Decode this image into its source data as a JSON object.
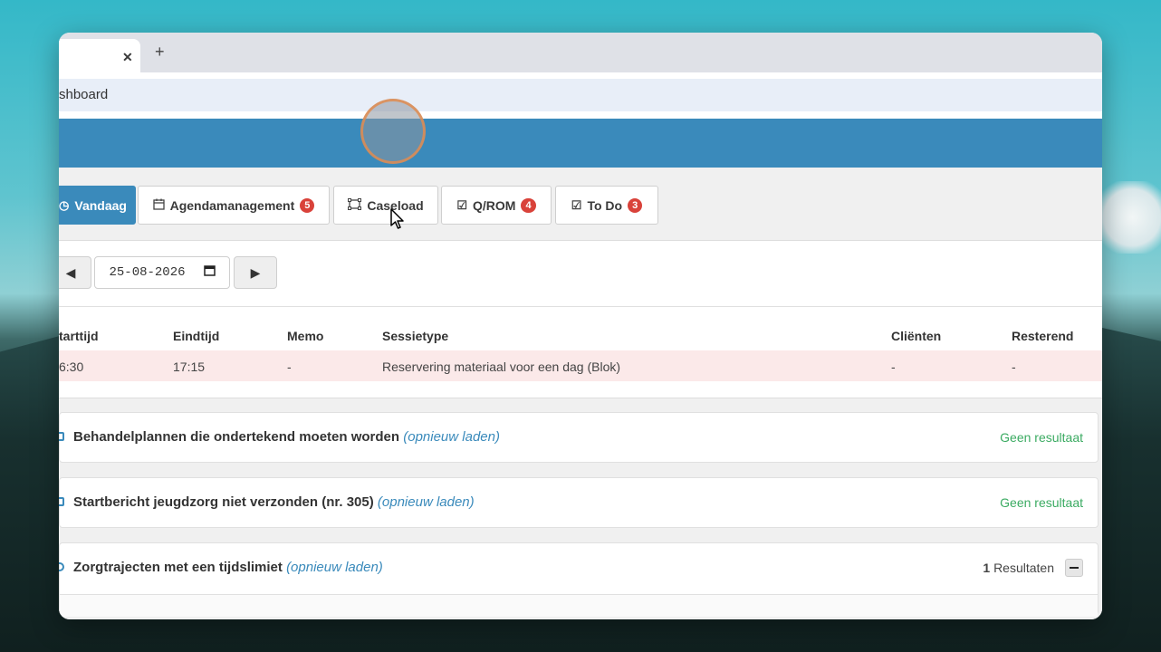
{
  "browser": {
    "tab": {
      "close_glyph": "✕"
    },
    "new_tab_glyph": "+",
    "address": "shboard"
  },
  "nav": [
    {
      "label": "Vandaag",
      "icon": "clock-icon",
      "badge": null,
      "active": true
    },
    {
      "label": "Agendamanagement",
      "icon": "calendar-icon",
      "badge": "5",
      "active": false
    },
    {
      "label": "Caseload",
      "icon": "caseload-icon",
      "badge": null,
      "active": false
    },
    {
      "label": "Q/ROM",
      "icon": "checkbox-icon",
      "badge": "4",
      "active": false
    },
    {
      "label": "To Do",
      "icon": "checkbox-icon",
      "badge": "3",
      "active": false
    }
  ],
  "date_nav": {
    "date": "25-08-2026",
    "prev_glyph": "◀",
    "next_glyph": "▶"
  },
  "session_table": {
    "headers": [
      "tarttijd",
      "Eindtijd",
      "Memo",
      "Sessietype",
      "Cliënten",
      "Resterend"
    ],
    "rows": [
      [
        "6:30",
        "17:15",
        "-",
        "Reservering materiaal voor een dag (Blok)",
        "-",
        "-"
      ]
    ]
  },
  "panels": [
    {
      "title": "Behandelplannen die ondertekend moeten worden",
      "reload": "(opnieuw laden)",
      "status": "Geen resultaat"
    },
    {
      "title": "Startbericht jeugdzorg niet verzonden (nr. 305)",
      "reload": "(opnieuw laden)",
      "status": "Geen resultaat"
    },
    {
      "title": "Zorgtrajecten met een tijdslimiet",
      "reload": "(opnieuw laden)",
      "results_count": "1",
      "results_label": "Resultaten"
    }
  ],
  "colors": {
    "header_blue": "#3a8abb",
    "badge_red": "#d9423a",
    "success_green": "#3bab62",
    "row_highlight": "#fbe9e9"
  }
}
